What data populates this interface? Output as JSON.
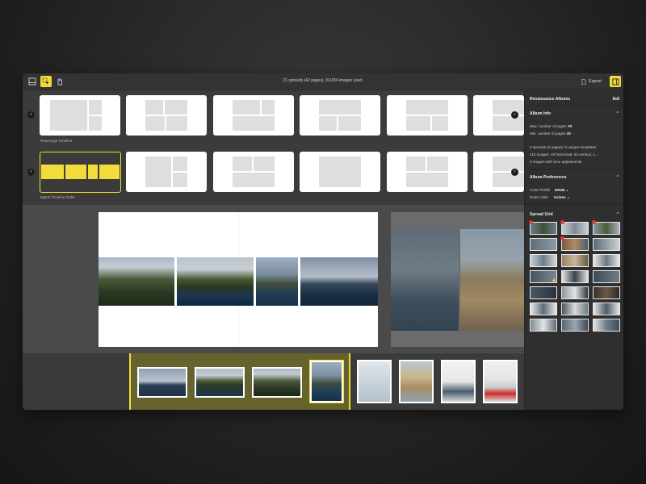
{
  "toolbar": {
    "status": "21 spreads (42 pages), 91/184 images used.",
    "export_label": "Export"
  },
  "templates": {
    "row1_label": "Rearrange Timeline",
    "row2_label": "Match Timeline Order",
    "prev_glyph": "‹",
    "next_glyph": "›"
  },
  "panel": {
    "album_title": "Renaissance Albums",
    "album_size": "8x8",
    "album_info_title": "Album Info",
    "max_pages_label": "Max. number of pages",
    "max_pages_value": "70",
    "min_pages_label": "Min. number of pages",
    "min_pages_value": "20",
    "stats_line1": "0 spreads (0 pages): 0 unique templates",
    "stats_line2": "113 images: 49 horizontal, 63 vertical, 1...",
    "stats_line3": "0 images with tone adjustments",
    "prefs_title": "Album Preferences",
    "color_profile_label": "Color Profile",
    "color_profile_value": "sRGB",
    "ruler_units_label": "Ruler Units",
    "ruler_units_value": "Inches",
    "spread_grid_title": "Spread Grid"
  },
  "colors": {
    "accent": "#f1dc3b",
    "window_bg": "#3b3b3b",
    "panel_bg": "#2f2f2f"
  }
}
